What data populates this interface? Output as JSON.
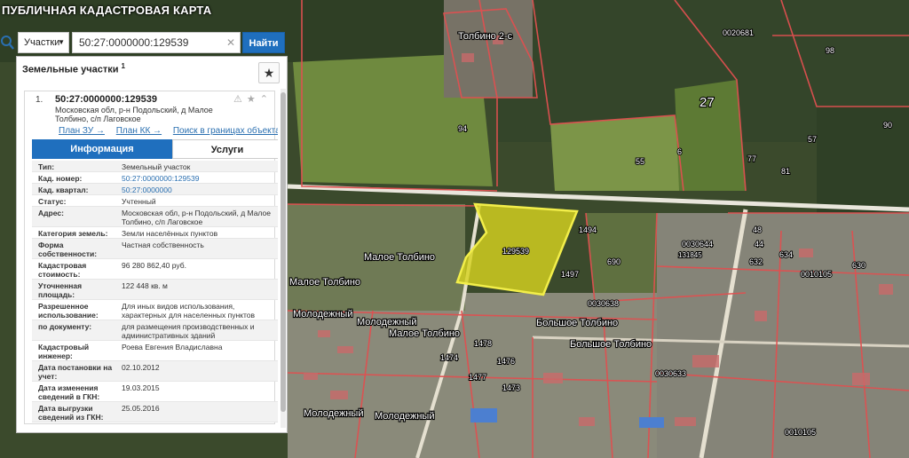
{
  "header": {
    "title": "ПУБЛИЧНАЯ КАДАСТРОВАЯ КАРТА"
  },
  "search": {
    "type_label": "Участки",
    "query": "50:27:0000000:129539",
    "find_label": "Найти"
  },
  "panel": {
    "title": "Земельные участки",
    "title_sup": "1",
    "item": {
      "number": "1.",
      "cad_number": "50:27:0000000:129539",
      "address": "Московская обл, р-н Подольский, д Малое Толбино, с/п Лаговское",
      "actions": "⚠ ★ ⌃",
      "links": [
        "План ЗУ →",
        "План КК →",
        "Поиск в границах объекта →"
      ]
    },
    "tabs": [
      "Информация",
      "Услуги"
    ],
    "rows": [
      {
        "k": "Тип:",
        "v": "Земельный участок"
      },
      {
        "k": "Кад. номер:",
        "v": "50:27:0000000:129539",
        "link": true
      },
      {
        "k": "Кад. квартал:",
        "v": "50:27:0000000",
        "link": true
      },
      {
        "k": "Статус:",
        "v": "Учтенный"
      },
      {
        "k": "Адрес:",
        "v": "Московская обл, р-н Подольский, д Малое Толбино, с/п Лаговское"
      },
      {
        "k": "Категория земель:",
        "v": "Земли населённых пунктов"
      },
      {
        "k": "Форма собственности:",
        "v": "Частная собственность"
      },
      {
        "k": "Кадастровая стоимость:",
        "v": "96 280 862,40 руб."
      },
      {
        "k": "Уточненная площадь:",
        "v": "122 448 кв. м"
      },
      {
        "k": "Разрешенное использование:",
        "v": "Для иных видов использования, характерных для населенных пунктов"
      },
      {
        "k": "по документу:",
        "v": "для размещения производственных и административных зданий"
      },
      {
        "k": "Кадастровый инженер:",
        "v": "Роева Евгения Владиславна"
      },
      {
        "k": "Дата постановки на учет:",
        "v": "02.10.2012"
      },
      {
        "k": "Дата изменения сведений в ГКН:",
        "v": "19.03.2015"
      },
      {
        "k": "Дата выгрузки сведений из ГКН:",
        "v": "25.05.2016"
      }
    ]
  },
  "map": {
    "labels": [
      "Толбино 2-с",
      "0020681",
      "27",
      "Малое Толбино",
      "Малое Толбино",
      "Малое Толбино",
      "Молодежный",
      "Молодежный",
      "Молодежный",
      "Молодежный",
      "Большое Толбино",
      "Большое Толбино",
      "0030644",
      "131845",
      "0030638",
      "0030633",
      "0010105",
      "0010105",
      "129539"
    ],
    "numbers": [
      "94",
      "55",
      "6",
      "98",
      "77",
      "57",
      "81",
      "90",
      "1494",
      "1497",
      "690",
      "44",
      "634",
      "630",
      "632",
      "48",
      "1478",
      "1474",
      "1477",
      "1476",
      "1473"
    ]
  },
  "colors": {
    "accent": "#1f6fbe",
    "parcel": "#d6d21e",
    "boundary": "#d43a3a"
  }
}
